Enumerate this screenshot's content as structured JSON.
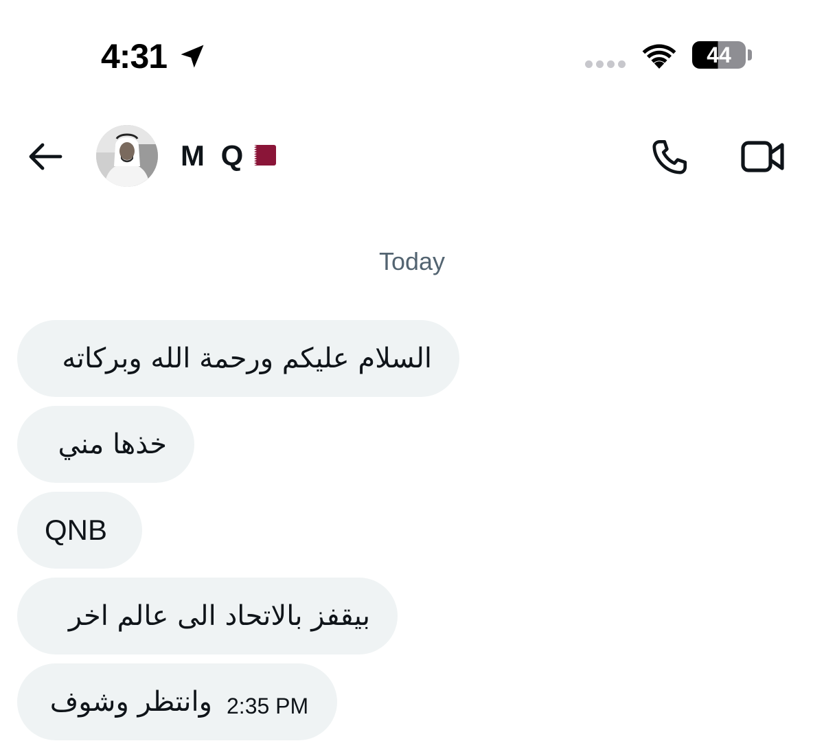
{
  "status_bar": {
    "time": "4:31",
    "battery_level": "44",
    "icons": [
      "location-arrow-icon",
      "cellular-signal-icon",
      "wifi-icon",
      "battery-icon"
    ]
  },
  "header": {
    "contact_name": "M Q",
    "contact_flag": "qatar-flag-icon",
    "icons": [
      "back-arrow-icon",
      "phone-icon",
      "video-camera-icon"
    ]
  },
  "conversation": {
    "date_divider": "Today",
    "messages": [
      {
        "text": "السلام عليكم ورحمة الله وبركاته"
      },
      {
        "text": "خذها مني"
      },
      {
        "text": "QNB"
      },
      {
        "text": "بيقفز بالاتحاد الى عالم اخر"
      },
      {
        "text": "وانتظر وشوف",
        "time": "2:35 PM"
      }
    ]
  },
  "colors": {
    "bubble_background": "#eff3f4",
    "secondary_text": "#536471",
    "primary_text": "#0f1419",
    "flag_maroon": "#8a1538"
  }
}
